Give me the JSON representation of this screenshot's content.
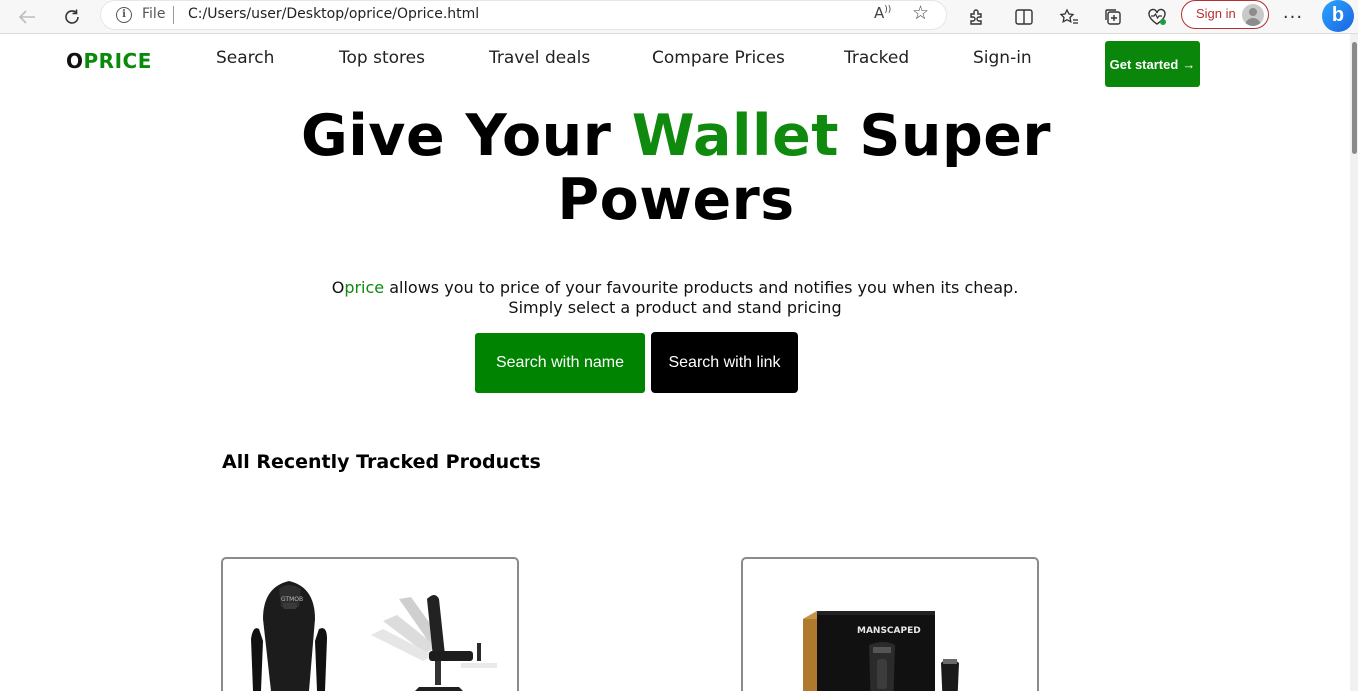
{
  "browser": {
    "address_scheme": "File",
    "url": "C:/Users/user/Desktop/oprice/Oprice.html",
    "sign_in_label": "Sign in"
  },
  "site": {
    "logo_first": "O",
    "logo_rest": "PRICE",
    "nav": [
      "Search",
      "Top stores",
      "Travel deals",
      "Compare Prices",
      "Tracked",
      "Sign-in"
    ],
    "cta_label": "Get started",
    "cta_arrow": "→"
  },
  "hero": {
    "title_part1": "Give Your ",
    "title_highlight": "Wallet",
    "title_part2": " Super Powers",
    "sub_brand_first": "O",
    "sub_brand_rest": "price",
    "subtitle_rest": " allows you to price of your favourite products and notifies you when its cheap. Simply select a product and stand pricing",
    "btn_search_name": "Search with name",
    "btn_search_link": "Search with link"
  },
  "recent": {
    "title": "All Recently Tracked Products",
    "products": [
      {
        "image": "gaming-chair",
        "brand_mark": "GTMOB"
      },
      {
        "image": "trimmer-box",
        "brand_mark": "MANSCAPED"
      }
    ]
  },
  "colors": {
    "brand_green": "#0a860a",
    "title_green": "#0f8a0f",
    "black_button": "#000000"
  }
}
